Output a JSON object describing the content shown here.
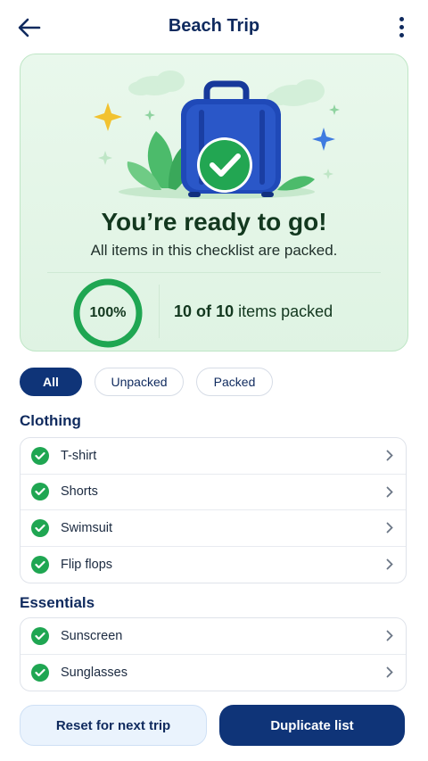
{
  "header": {
    "title": "Beach Trip",
    "back_icon": "arrow-left-icon",
    "more_icon": "more-vertical-icon"
  },
  "hero": {
    "title": "You’re ready to go!",
    "subtitle": "All items in this checklist are packed.",
    "progress_percent_label": "100%",
    "progress_value": 1.0,
    "packed_done": "10",
    "packed_of": "of",
    "packed_total": "10",
    "packed_suffix": "items packed",
    "colors": {
      "accent_green": "#1fa652",
      "suitcase_blue": "#1f49b8",
      "sparkle_gold": "#f2c230",
      "sparkle_blue": "#3f7be0"
    }
  },
  "filters": {
    "all": "All",
    "unpacked": "Unpacked",
    "packed": "Packed",
    "selected": "All"
  },
  "sections": [
    {
      "title": "Clothing",
      "items": [
        {
          "label": "T-shirt",
          "packed": true
        },
        {
          "label": "Shorts",
          "packed": true
        },
        {
          "label": "Swimsuit",
          "packed": true
        },
        {
          "label": "Flip flops",
          "packed": true
        }
      ]
    },
    {
      "title": "Essentials",
      "items": [
        {
          "label": "Sunscreen",
          "packed": true
        },
        {
          "label": "Sunglasses",
          "packed": true
        }
      ]
    }
  ],
  "actions": {
    "reset": "Reset for next trip",
    "duplicate": "Duplicate list"
  },
  "colors": {
    "primary": "#0f3478",
    "text": "#0f2a5e",
    "check": "#1fa652"
  }
}
